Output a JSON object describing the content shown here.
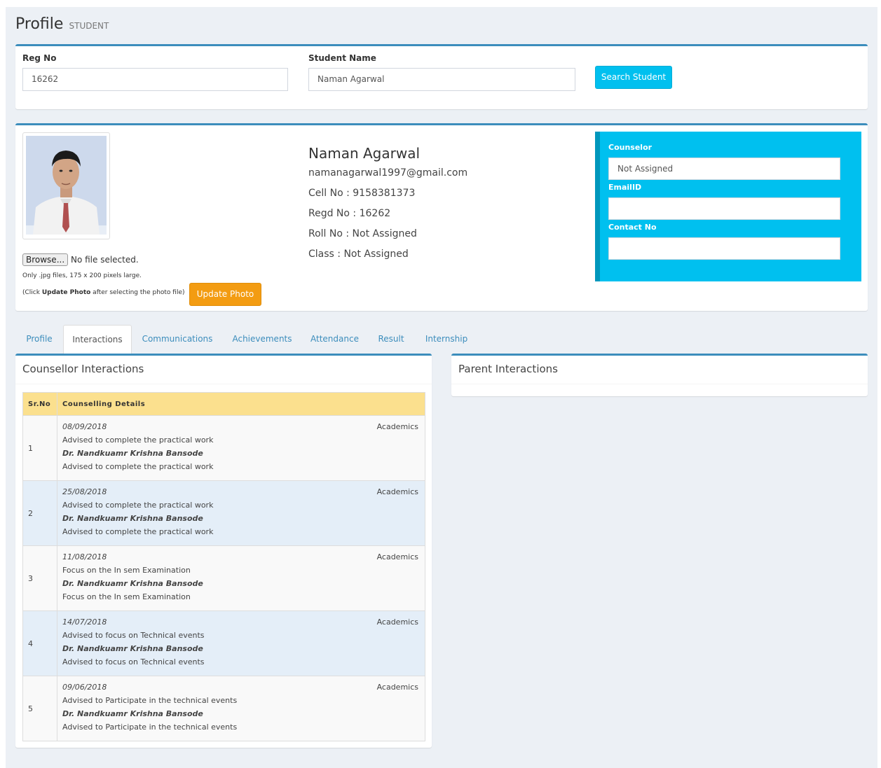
{
  "header": {
    "title": "Profile",
    "subtitle": "STUDENT"
  },
  "search": {
    "reg_label": "Reg No",
    "reg_value": "16262",
    "name_label": "Student Name",
    "name_value": "Naman Agarwal",
    "button_label": "Search Student"
  },
  "profile": {
    "browse_label": "Browse...",
    "file_status": "No file selected.",
    "hint_size": "Only .jpg files, 175 x 200 pixels large.",
    "hint_click_pre": "(Click ",
    "hint_click_bold": "Update Photo",
    "hint_click_post": " after selecting the photo file)",
    "update_photo_label": "Update Photo",
    "name": "Naman Agarwal",
    "email": "namanagarwal1997@gmail.com",
    "cell": "Cell No : 9158381373",
    "regd": "Regd No : 16262",
    "roll": "Roll No : Not Assigned",
    "class": "Class : Not Assigned"
  },
  "counselor_panel": {
    "counselor_label": "Counselor",
    "counselor_value": "Not Assigned",
    "email_label": "EmailID",
    "email_value": "",
    "contact_label": "Contact No",
    "contact_value": ""
  },
  "tabs": [
    "Profile",
    "Interactions",
    "Communications",
    "Achievements",
    "Attendance",
    "Result",
    "Internship"
  ],
  "active_tab": "Interactions",
  "counsellor_interactions": {
    "title": "Counsellor Interactions",
    "headers": [
      "Sr.No",
      "Counselling Details"
    ],
    "rows": [
      {
        "sr": "1",
        "date": "08/09/2018",
        "line1": "Advised to complete the practical work",
        "counsellor": "Dr. Nandkuamr Krishna Bansode",
        "line2": "Advised to complete the practical work",
        "category": "Academics"
      },
      {
        "sr": "2",
        "date": "25/08/2018",
        "line1": "Advised to complete the practical work",
        "counsellor": "Dr. Nandkuamr Krishna Bansode",
        "line2": "Advised to complete the practical work",
        "category": "Academics"
      },
      {
        "sr": "3",
        "date": "11/08/2018",
        "line1": "Focus on the In sem Examination",
        "counsellor": "Dr. Nandkuamr Krishna Bansode",
        "line2": "Focus on the In sem Examination",
        "category": "Academics"
      },
      {
        "sr": "4",
        "date": "14/07/2018",
        "line1": "Advised to focus on Technical events",
        "counsellor": "Dr. Nandkuamr Krishna Bansode",
        "line2": "Advised to focus on Technical events",
        "category": "Academics"
      },
      {
        "sr": "5",
        "date": "09/06/2018",
        "line1": "Advised to Participate in the technical events",
        "counsellor": "Dr. Nandkuamr Krishna Bansode",
        "line2": "Advised to Participate in the technical events",
        "category": "Academics"
      }
    ]
  },
  "parent_interactions": {
    "title": "Parent Interactions"
  },
  "colors": {
    "accent": "#3c8dbc",
    "info": "#00c0ef",
    "warning": "#f39c12",
    "table_header": "#fbe08e"
  }
}
